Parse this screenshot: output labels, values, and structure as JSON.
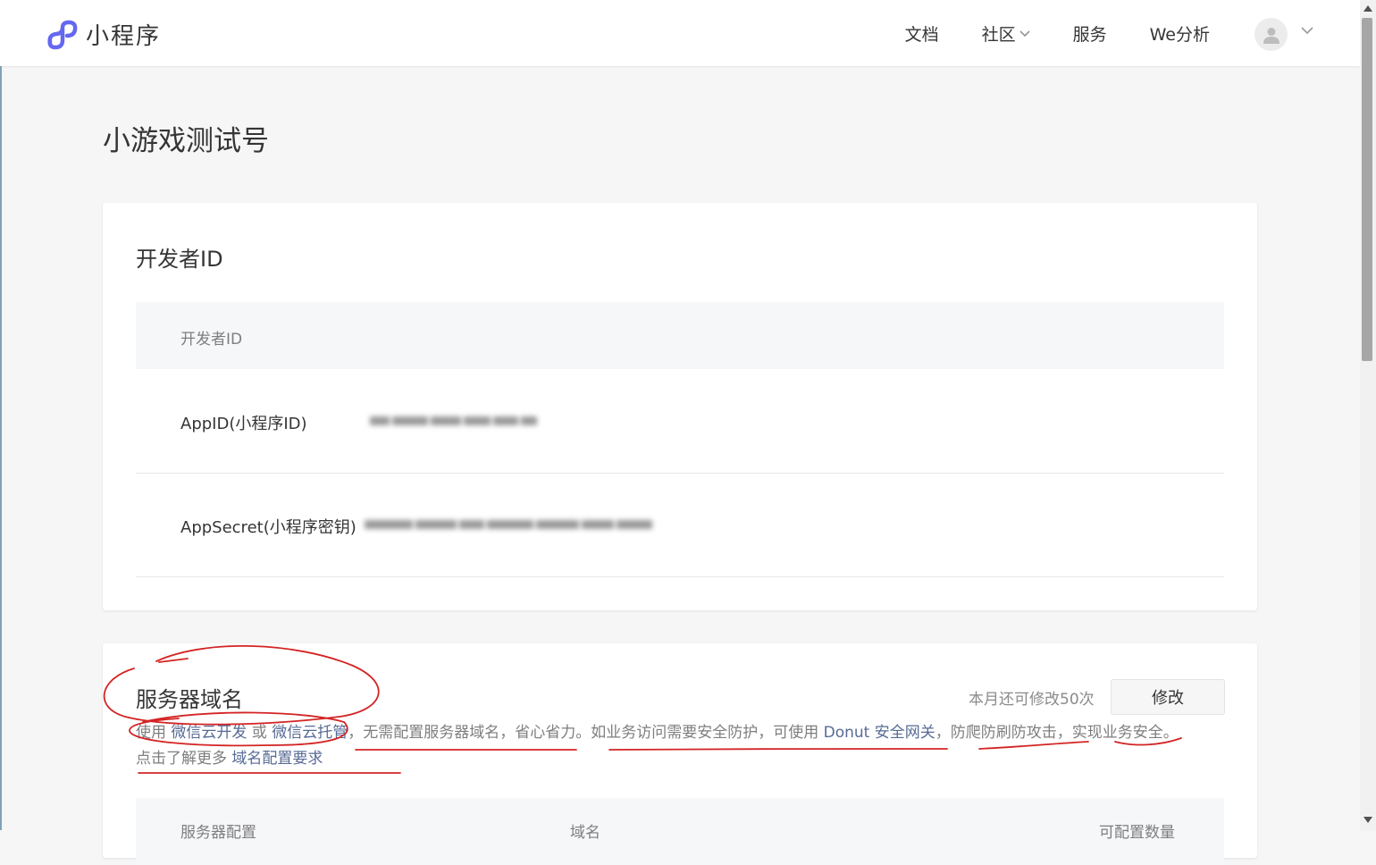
{
  "header": {
    "logo_text": "小程序",
    "nav": [
      {
        "label": "文档"
      },
      {
        "label": "社区"
      },
      {
        "label": "服务"
      },
      {
        "label": "We分析"
      }
    ]
  },
  "page": {
    "title": "小游戏测试号"
  },
  "developer_card": {
    "title": "开发者ID",
    "table_header": "开发者ID",
    "rows": [
      {
        "label": "AppID(小程序ID)"
      },
      {
        "label": "AppSecret(小程序密钥)"
      }
    ]
  },
  "server_card": {
    "title": "服务器域名",
    "quota_text": "本月还可修改50次",
    "modify_label": "修改",
    "desc": {
      "t1": "使用 ",
      "link1": "微信云开发",
      "t2": " 或 ",
      "link2": "微信云托管",
      "t3": "，无需配置服务器域名，省心省力。如业务访问需要安全防护，可使用 ",
      "link3": "Donut 安全网关",
      "t4": "，防爬防刷防攻击，实现业务安全。",
      "t5": "点击了解更多 ",
      "link4": "域名配置要求"
    },
    "columns": [
      "服务器配置",
      "域名",
      "可配置数量"
    ]
  },
  "colors": {
    "accent": "#576b95",
    "logo_purple": "#6467f0",
    "annotation_red": "#d42424"
  }
}
